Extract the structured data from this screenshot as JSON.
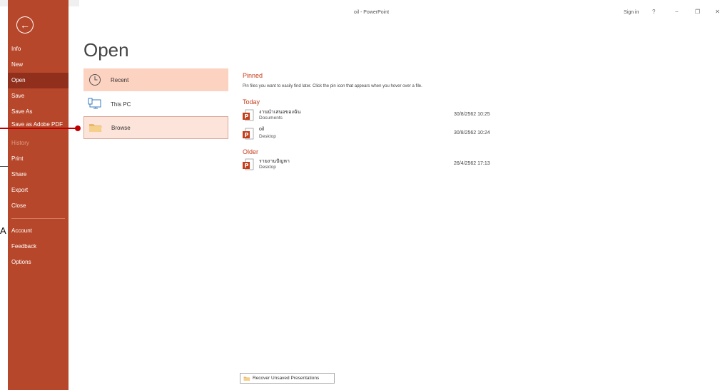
{
  "window": {
    "title": "oil  -  PowerPoint",
    "sign_in": "Sign in",
    "help": "?",
    "minimize": "−",
    "restore": "❐",
    "close": "✕"
  },
  "sidebar": {
    "back_icon": "arrow-left-icon",
    "items": [
      {
        "label": "Info"
      },
      {
        "label": "New"
      },
      {
        "label": "Open"
      },
      {
        "label": "Save"
      },
      {
        "label": "Save As"
      },
      {
        "label": "Save as Adobe PDF"
      },
      {
        "label": "History"
      },
      {
        "label": "Print"
      },
      {
        "label": "Share"
      },
      {
        "label": "Export"
      },
      {
        "label": "Close"
      },
      {
        "label": "Account"
      },
      {
        "label": "Feedback"
      },
      {
        "label": "Options"
      }
    ],
    "accent": "#b7472a",
    "active_bg": "#8f2f1c"
  },
  "outside": {
    "letter": "A"
  },
  "page": {
    "title": "Open"
  },
  "locations": [
    {
      "label": "Recent",
      "icon": "clock-icon"
    },
    {
      "label": "This PC",
      "icon": "computer-icon"
    },
    {
      "label": "Browse",
      "icon": "folder-icon"
    }
  ],
  "recent": {
    "pinned_heading": "Pinned",
    "pinned_note": "Pin files you want to easily find later. Click the pin icon that appears when you hover over a file.",
    "today_heading": "Today",
    "older_heading": "Older",
    "today_files": [
      {
        "name": "งานนำเสนอของฉัน",
        "location": "Documents",
        "date": "30/8/2562 10:25"
      },
      {
        "name": "oil",
        "location": "Desktop",
        "date": "30/8/2562 10:24"
      }
    ],
    "older_files": [
      {
        "name": "รายงานปัญหา",
        "location": "Desktop",
        "date": "26/4/2562 17:13"
      }
    ]
  },
  "recover_button": "Recover Unsaved Presentations",
  "colors": {
    "heading": "#c43e1c",
    "recent_selected": "#fcd2c1",
    "browse_hover": "#fde4da"
  }
}
